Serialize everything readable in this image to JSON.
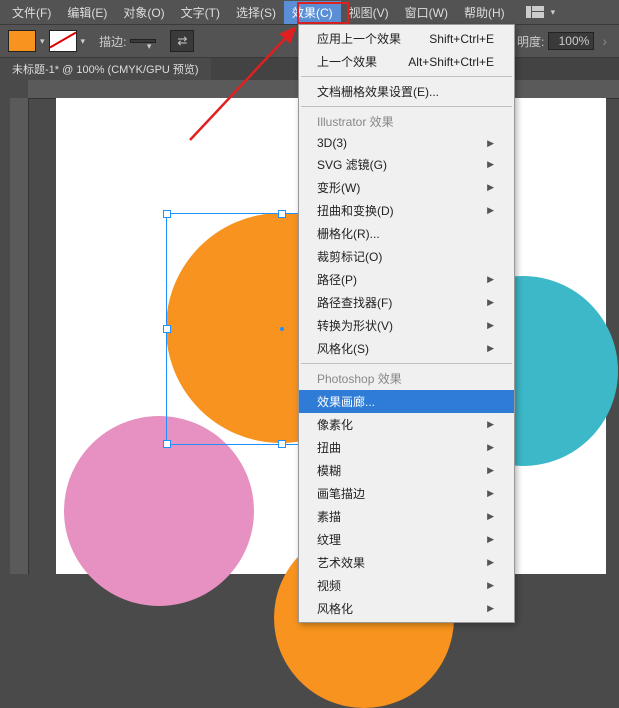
{
  "menubar": {
    "items": [
      "文件(F)",
      "编辑(E)",
      "对象(O)",
      "文字(T)",
      "选择(S)",
      "效果(C)",
      "视图(V)",
      "窗口(W)",
      "帮助(H)"
    ],
    "active_index": 5
  },
  "toolbar": {
    "stroke_label": "描边:",
    "stroke_value": "",
    "swap_glyph": "⇄",
    "opacity_label": "明度:",
    "opacity_value": "100%"
  },
  "tab": {
    "label": "未标题-1* @ 100% (CMYK/GPU 预览)"
  },
  "dropdown": {
    "top": [
      {
        "label": "应用上一个效果",
        "shortcut": "Shift+Ctrl+E"
      },
      {
        "label": "上一个效果",
        "shortcut": "Alt+Shift+Ctrl+E"
      }
    ],
    "doc_grid": "文档栅格效果设置(E)...",
    "header1": "Illustrator 效果",
    "group1": [
      "3D(3)",
      "SVG 滤镜(G)",
      "变形(W)",
      "扭曲和变换(D)",
      "栅格化(R)...",
      "裁剪标记(O)",
      "路径(P)",
      "路径查找器(F)",
      "转换为形状(V)",
      "风格化(S)"
    ],
    "header2": "Photoshop 效果",
    "gallery": "效果画廊...",
    "group2": [
      "像素化",
      "扭曲",
      "模糊",
      "画笔描边",
      "素描",
      "纹理",
      "艺术效果",
      "视频",
      "风格化"
    ]
  },
  "circles": {
    "orange_main": {
      "color": "#f7931e"
    },
    "pink": {
      "color": "#e691c1"
    },
    "teal": {
      "color": "#3cb8c9"
    },
    "orange_small": {
      "color": "#f7931e"
    }
  }
}
